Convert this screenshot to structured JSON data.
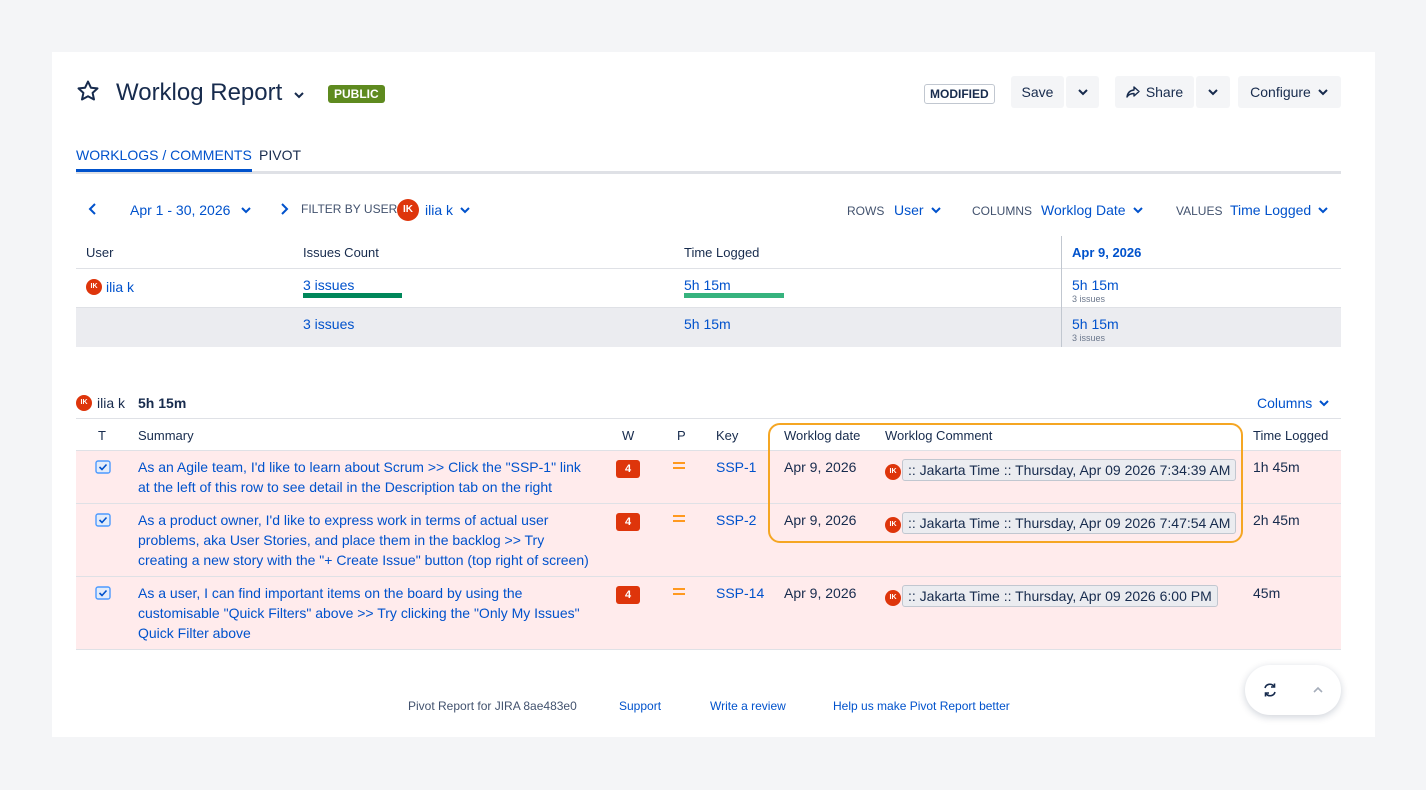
{
  "header": {
    "title": "Worklog Report",
    "visibility_badge": "PUBLIC",
    "modified_badge": "MODIFIED",
    "save_label": "Save",
    "share_label": "Share",
    "configure_label": "Configure"
  },
  "tabs": [
    {
      "label": "WORKLOGS / COMMENTS",
      "active": true
    },
    {
      "label": "PIVOT",
      "active": false
    }
  ],
  "filters": {
    "date_range": "Apr 1 - 30, 2026",
    "filter_by_user_label": "FILTER BY USER",
    "user_initials": "IK",
    "user_name": "ilia k",
    "rows_label": "ROWS",
    "rows_value": "User",
    "columns_label": "COLUMNS",
    "columns_value": "Worklog Date",
    "values_label": "VALUES",
    "values_value": "Time Logged"
  },
  "pivot": {
    "headers": {
      "user": "User",
      "issues_count": "Issues Count",
      "time_logged": "Time Logged",
      "date_col": "Apr 9, 2026"
    },
    "rows": [
      {
        "initials": "IK",
        "user": "ilia k",
        "issues": "3 issues",
        "time": "5h 15m",
        "date_time": "5h 15m",
        "date_issues": "3 issues"
      }
    ],
    "total": {
      "issues": "3 issues",
      "time": "5h 15m",
      "date_time": "5h 15m",
      "date_issues": "3 issues"
    }
  },
  "detail": {
    "group_initials": "IK",
    "group_user": "ilia k",
    "group_total": "5h 15m",
    "columns_button": "Columns",
    "headers": {
      "t": "T",
      "summary": "Summary",
      "w": "W",
      "p": "P",
      "key": "Key",
      "worklog_date": "Worklog date",
      "worklog_comment": "Worklog Comment",
      "time_logged": "Time Logged"
    },
    "rows": [
      {
        "summary_lines": [
          "As an Agile team, I'd like to learn about Scrum >> Click the \"SSP-1\" link",
          "at the left of this row to see detail in the Description tab on the right"
        ],
        "w": "4",
        "key": "SSP-1",
        "date": "Apr 9, 2026",
        "initials": "IK",
        "comment": ":: Jakarta Time :: Thursday, Apr 09 2026 7:34:39 AM",
        "time": "1h 45m"
      },
      {
        "summary_lines": [
          "As a product owner, I'd like to express work in terms of actual user",
          "problems, aka User Stories, and place them in the backlog >> Try",
          "creating a new story with the \"+ Create Issue\" button (top right of screen)"
        ],
        "w": "4",
        "key": "SSP-2",
        "date": "Apr 9, 2026",
        "initials": "IK",
        "comment": ":: Jakarta Time :: Thursday, Apr 09 2026 7:47:54 AM",
        "time": "2h 45m"
      },
      {
        "summary_lines": [
          "As a user, I can find important items on the board by using the",
          "customisable \"Quick Filters\" above >> Try clicking the \"Only My Issues\"",
          "Quick Filter above"
        ],
        "w": "4",
        "key": "SSP-14",
        "date": "Apr 9, 2026",
        "initials": "IK",
        "comment": ":: Jakarta Time :: Thursday, Apr 09 2026 6:00 PM",
        "time": "45m"
      }
    ]
  },
  "footer": {
    "version": "Pivot Report for JIRA 8ae483e0",
    "support": "Support",
    "review": "Write a review",
    "help": "Help us make Pivot Report better"
  },
  "colors": {
    "accent": "#0052cc",
    "row_highlight": "#ffebec",
    "badge_green": "#5e8a1f",
    "priority_badge": "#de350b",
    "highlight_outline": "#f5a623"
  }
}
